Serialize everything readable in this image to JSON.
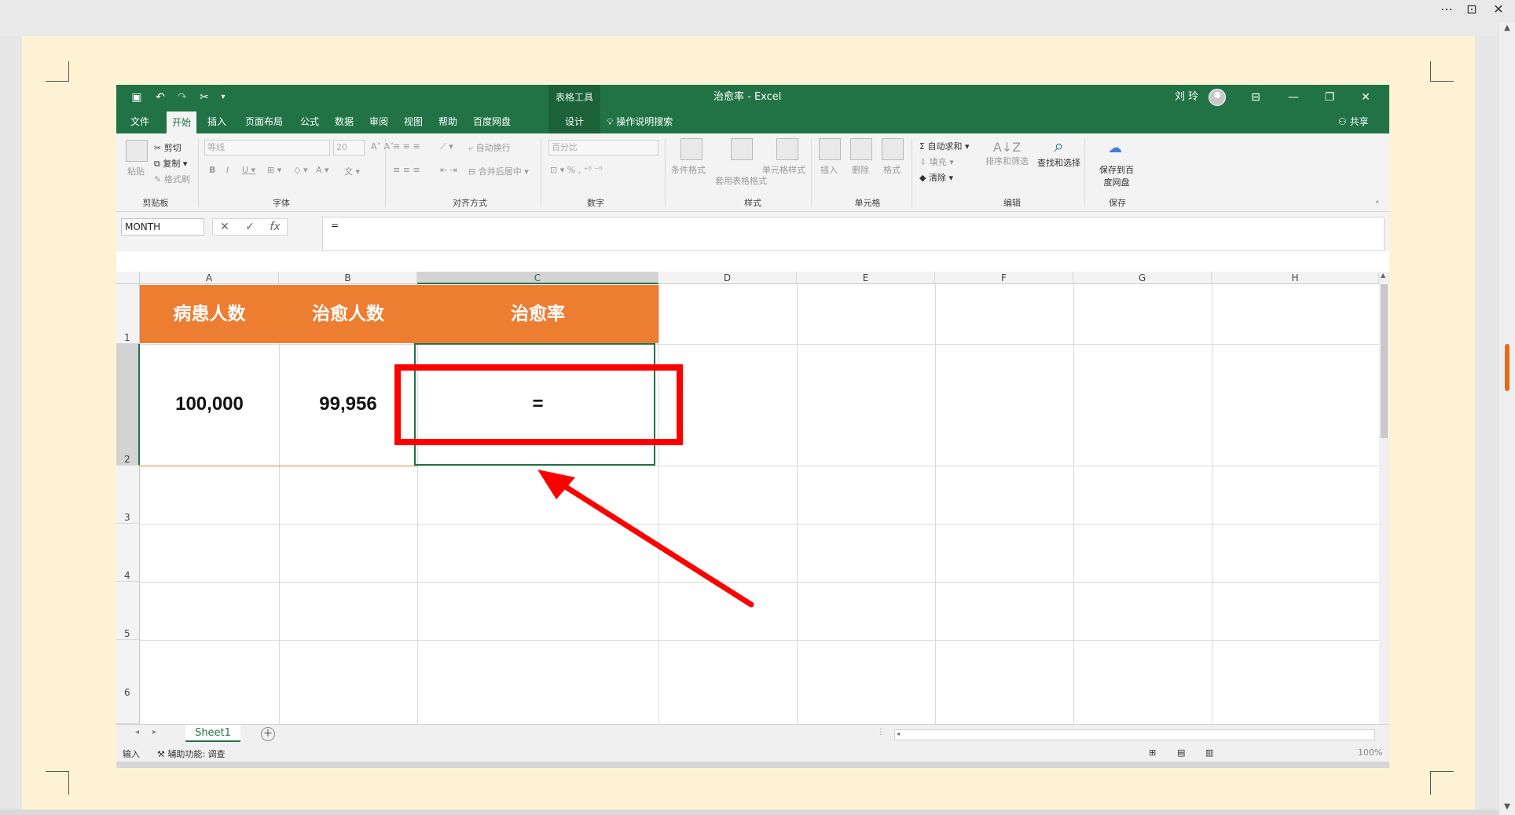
{
  "excel": {
    "title": "治愈率 - Excel",
    "context_tab": "表格工具",
    "user": "刘 玲",
    "tabs": [
      "文件",
      "开始",
      "插入",
      "页面布局",
      "公式",
      "数据",
      "审阅",
      "视图",
      "帮助",
      "百度网盘",
      "设计"
    ],
    "tell_me": "操作说明搜索",
    "share": "共享",
    "ribbon": {
      "clipboard": {
        "label": "剪贴板",
        "paste": "粘贴",
        "cut": "剪切",
        "copy": "复制",
        "format_painter": "格式刷"
      },
      "font": {
        "label": "字体",
        "font_name": "等线",
        "font_size": "20"
      },
      "alignment": {
        "label": "对齐方式",
        "wrap": "自动换行",
        "merge": "合并后居中"
      },
      "number": {
        "label": "数字",
        "format": "百分比"
      },
      "styles": {
        "label": "样式",
        "conditional": "条件格式",
        "table_format": "套用表格格式",
        "cell_styles": "单元格样式"
      },
      "cells": {
        "label": "单元格",
        "insert": "插入",
        "delete": "删除",
        "format": "格式"
      },
      "editing": {
        "label": "编辑",
        "autosum": "自动求和",
        "fill": "填充",
        "clear": "清除",
        "sort": "排序和筛选",
        "find": "查找和选择"
      },
      "save": {
        "label": "保存",
        "save_to": "保存到百度网盘"
      }
    },
    "name_box": "MONTH",
    "formula": "=",
    "columns": [
      "A",
      "B",
      "C",
      "D",
      "E",
      "F",
      "G",
      "H"
    ],
    "rows": [
      "1",
      "2",
      "3",
      "4",
      "5",
      "6"
    ],
    "cells": {
      "A1": "病患人数",
      "B1": "治愈人数",
      "C1": "治愈率",
      "A2": "100,000",
      "B2": "99,956",
      "C2": "="
    },
    "sheet": "Sheet1",
    "status": {
      "mode": "输入",
      "accessibility": "辅助功能: 调查",
      "zoom": "100%"
    }
  },
  "colors": {
    "excel_green": "#217346",
    "header_orange": "#ed7d31",
    "annotation_red": "#ff0000"
  }
}
